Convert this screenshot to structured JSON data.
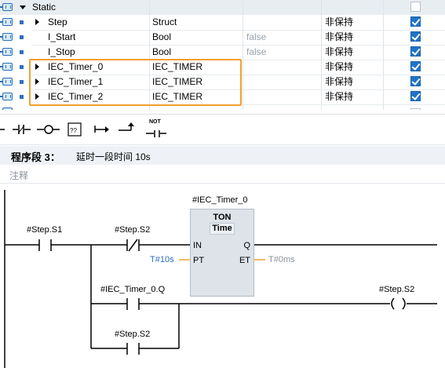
{
  "table": {
    "rows": [
      {
        "name": "Static",
        "type": "",
        "default": "",
        "retain": "",
        "check": "off",
        "expanded": true,
        "level": 0,
        "header": true
      },
      {
        "name": "Step",
        "type": "Struct",
        "default": "",
        "retain": "非保持",
        "check": "on",
        "expand": true,
        "level": 1
      },
      {
        "name": "I_Start",
        "type": "Bool",
        "default": "false",
        "retain": "非保持",
        "check": "on",
        "level": 1
      },
      {
        "name": "I_Stop",
        "type": "Bool",
        "default": "false",
        "retain": "非保持",
        "check": "on",
        "level": 1
      },
      {
        "name": "IEC_Timer_0",
        "type": "IEC_TIMER",
        "default": "",
        "retain": "非保持",
        "check": "on",
        "expand": true,
        "level": 1
      },
      {
        "name": "IEC_Timer_1",
        "type": "IEC_TIMER",
        "default": "",
        "retain": "非保持",
        "check": "on",
        "expand": true,
        "level": 1
      },
      {
        "name": "IEC_Timer_2",
        "type": "IEC_TIMER",
        "default": "",
        "retain": "非保持",
        "check": "on",
        "expand": true,
        "level": 1
      }
    ]
  },
  "toolbar": {
    "buttons": [
      "branch-icon",
      "no-contact-icon",
      "nc-contact-icon",
      "coil-icon",
      "empty-box-icon",
      "open-branch-icon",
      "close-branch-icon",
      "not-icon"
    ],
    "not_label": "NOT"
  },
  "network": {
    "label": "程序段 3：",
    "title": "延时一段时间 10s",
    "comment_placeholder": "注释"
  },
  "ladder": {
    "contact1": "#Step.S1",
    "contact2": "#Step.S2",
    "timer_instance": "#IEC_Timer_0",
    "timer_type": "TON",
    "timer_subtype": "Time",
    "pin_in": "IN",
    "pin_pt": "PT",
    "pin_q": "Q",
    "pin_et": "ET",
    "pt_value": "T#10s",
    "et_value": "T#0ms",
    "contact3": "#IEC_Timer_0.Q",
    "contact4": "#Step.S2",
    "coil": "#Step.S2"
  }
}
